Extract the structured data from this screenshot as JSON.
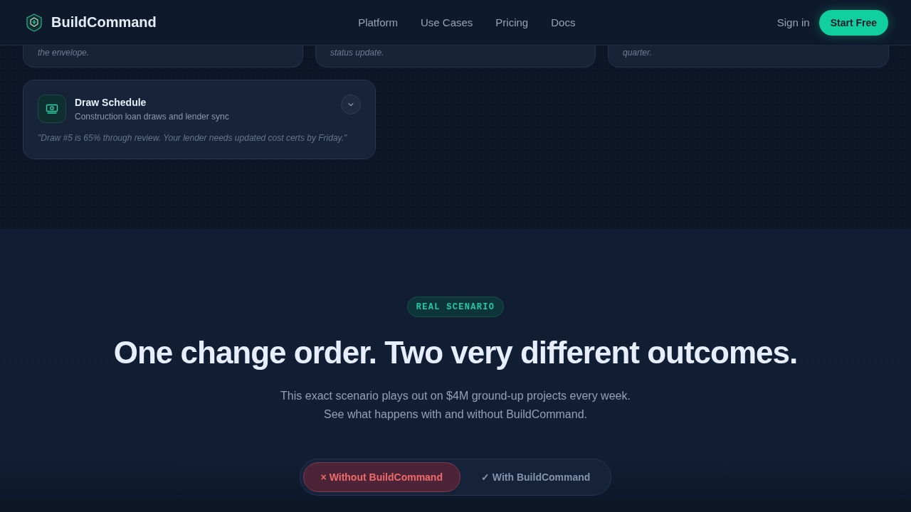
{
  "header": {
    "brand": "BuildCommand",
    "nav": [
      {
        "label": "Platform"
      },
      {
        "label": "Use Cases"
      },
      {
        "label": "Pricing"
      },
      {
        "label": "Docs"
      }
    ],
    "sign_in": "Sign in",
    "cta": "Start Free"
  },
  "cards_row": [
    {
      "quote_tail": "the envelope."
    },
    {
      "quote_tail": "status update."
    },
    {
      "quote_tail": "quarter."
    }
  ],
  "feature_card": {
    "title": "Draw Schedule",
    "subtitle": "Construction loan draws and lender sync",
    "quote": "\"Draw #5 is 65% through review. Your lender needs updated cost certs by Friday.\"",
    "expanded": false
  },
  "scenario": {
    "badge": "REAL SCENARIO",
    "heading": "One change order. Two very different outcomes.",
    "subtitle_lines": [
      "This exact scenario plays out on $4M ground-up projects every week.",
      "See what happens with and without BuildCommand."
    ],
    "toggle": [
      {
        "label": "× Without BuildCommand",
        "kind": "without",
        "selected": true
      },
      {
        "label": "✓ With BuildCommand",
        "kind": "with",
        "selected": false
      }
    ]
  }
}
